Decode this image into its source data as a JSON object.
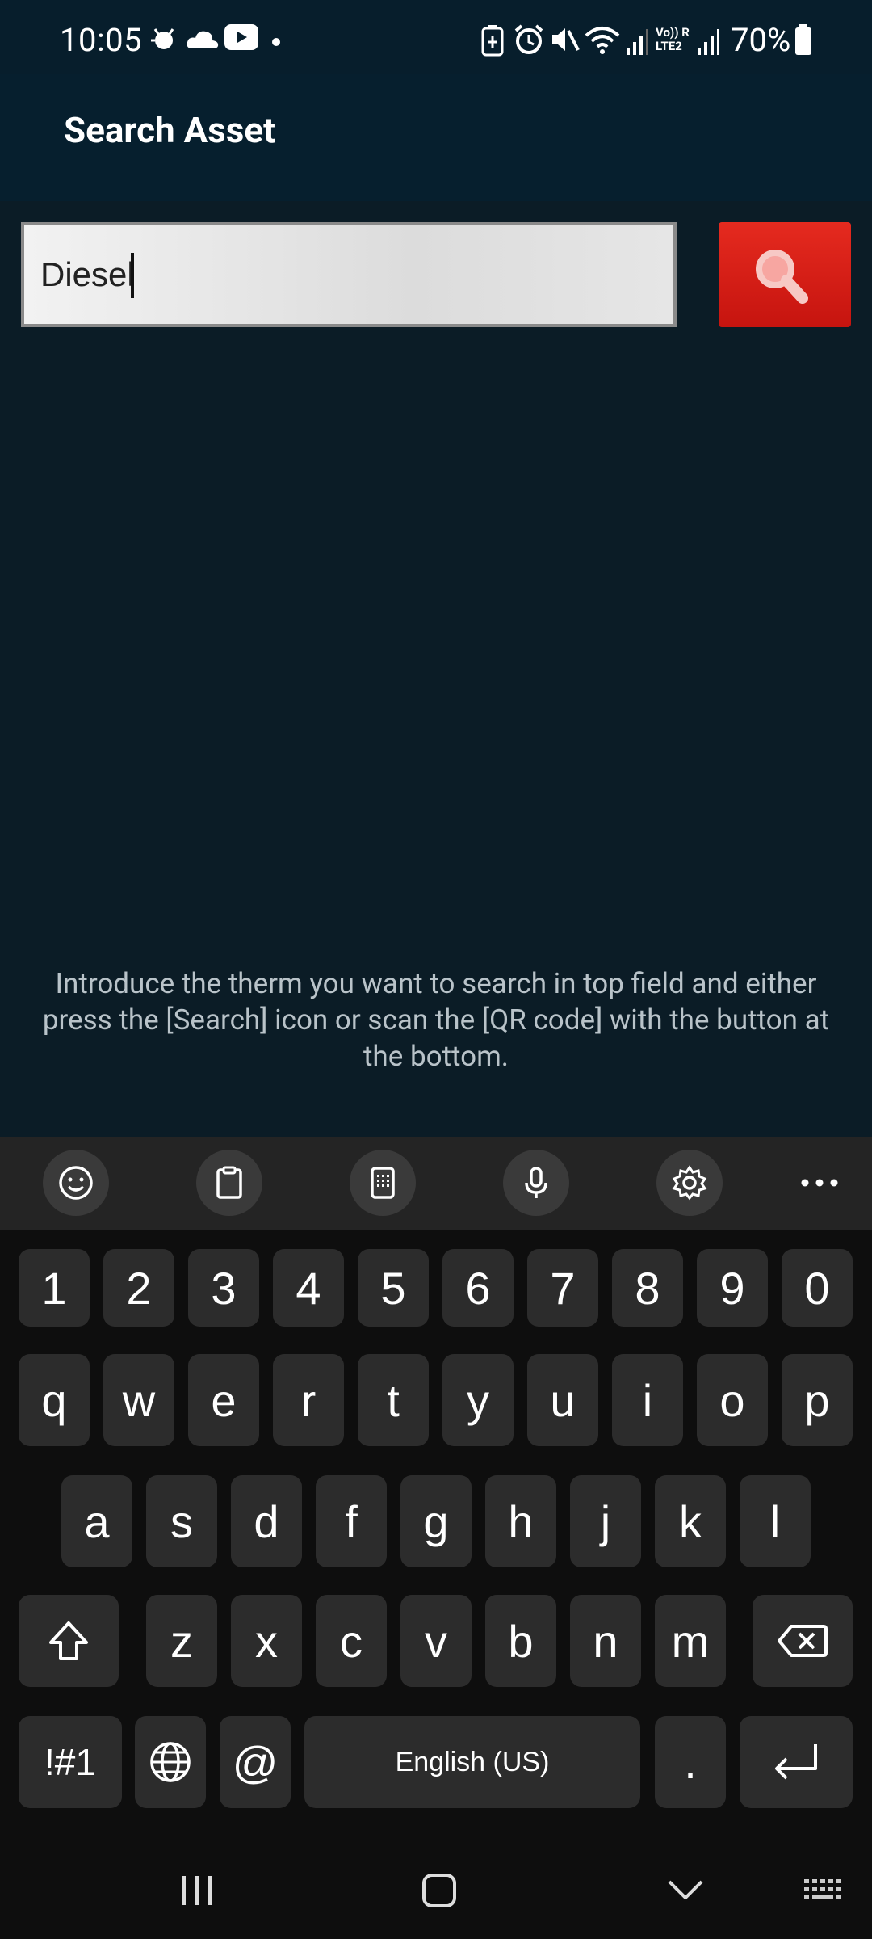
{
  "status_bar": {
    "time": "10:05",
    "battery": "70%",
    "network_label_top": "Vo)) R",
    "network_label_bottom": "LTE2",
    "icons": [
      "weather-icon",
      "cloud-icon",
      "youtube-icon",
      "dot-icon",
      "battery-saver-icon",
      "alarm-icon",
      "mute-icon",
      "wifi-icon",
      "signal-icon",
      "signal2-icon",
      "battery-icon"
    ]
  },
  "app_bar": {
    "title": "Search Asset"
  },
  "search": {
    "value": "Diesel",
    "button_icon": "search-icon"
  },
  "instructions": "Introduce the therm you want to search in top field and either press the [Search] icon or scan the [QR code] with the button at the bottom.",
  "keyboard": {
    "toolbar": [
      "emoji-icon",
      "clipboard-icon",
      "keypad-icon",
      "microphone-icon",
      "settings-icon",
      "more-icon"
    ],
    "numbers": [
      "1",
      "2",
      "3",
      "4",
      "5",
      "6",
      "7",
      "8",
      "9",
      "0"
    ],
    "row1": [
      "q",
      "w",
      "e",
      "r",
      "t",
      "y",
      "u",
      "i",
      "o",
      "p"
    ],
    "row2": [
      "a",
      "s",
      "d",
      "f",
      "g",
      "h",
      "j",
      "k",
      "l"
    ],
    "row3": [
      "z",
      "x",
      "c",
      "v",
      "b",
      "n",
      "m"
    ],
    "symbols_label": "!#1",
    "at_label": "@",
    "space_label": "English (US)",
    "period_label": "."
  },
  "colors": {
    "accent": "#d41c14",
    "background": "#0b1c26",
    "app_bar": "#061f2e"
  }
}
